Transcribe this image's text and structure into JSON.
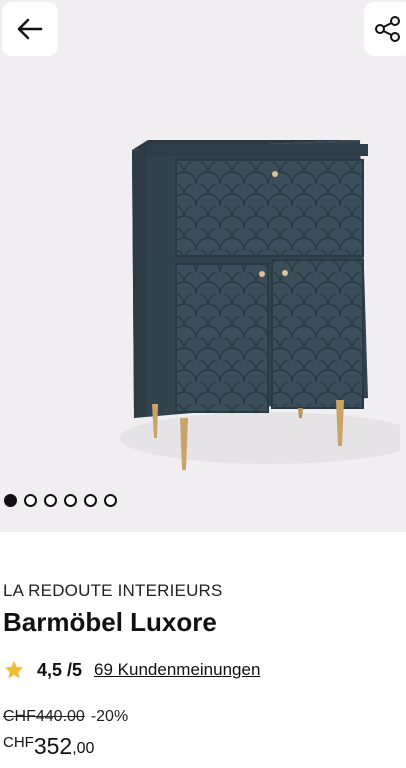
{
  "header": {
    "back_icon": "arrow-left-icon",
    "share_icon": "share-icon"
  },
  "gallery": {
    "image_description_icon": "product-photo",
    "dots": [
      true,
      false,
      false,
      false,
      false,
      false
    ]
  },
  "product": {
    "brand": "LA REDOUTE INTERIEURS",
    "title": "Barmöbel Luxore",
    "rating": "4,5 /5",
    "reviews": "69 Kundenmeinungen",
    "old_price": "CHF440.00",
    "discount": "-20%",
    "currency": "CHF",
    "price_main": "352",
    "price_cents": ",00"
  },
  "colors": {
    "cabinet": "#3a4b56",
    "legs": "#c8a46a",
    "star": "#f1bd2e",
    "background": "#f1eef1"
  }
}
